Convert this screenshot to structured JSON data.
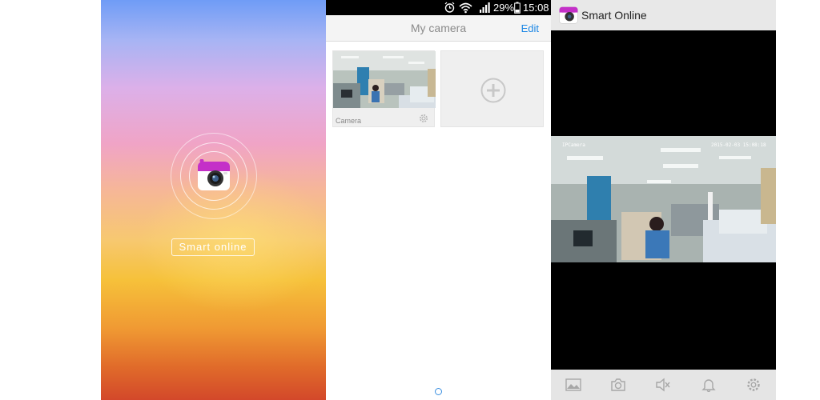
{
  "splash": {
    "app_label": "Smart online"
  },
  "camera_list": {
    "status_bar": {
      "battery": "29%",
      "time": "15:08"
    },
    "header": {
      "title": "My camera",
      "edit_label": "Edit"
    },
    "cameras": [
      {
        "name": "Camera"
      }
    ]
  },
  "live_view": {
    "app_title": "Smart Online",
    "overlay_camera_name": "IPCamera",
    "overlay_timestamp": "2015-02-03 15:08:18",
    "toolbar": [
      "gallery-icon",
      "camera-icon",
      "mute-icon",
      "bell-icon",
      "gear-icon"
    ]
  },
  "colors": {
    "accent_blue": "#1e88e5",
    "brand_magenta": "#c430c8"
  }
}
